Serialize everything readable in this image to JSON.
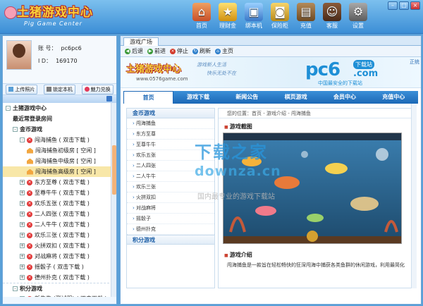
{
  "app": {
    "logo_title": "土猪游戏中心",
    "logo_subtitle": "Pig Game Center"
  },
  "toolbar": [
    {
      "label": "首页",
      "icon": "home-icon"
    },
    {
      "label": "理财金",
      "icon": "gold-icon"
    },
    {
      "label": "绑本机",
      "icon": "bind-pc-icon"
    },
    {
      "label": "保险柜",
      "icon": "safe-icon"
    },
    {
      "label": "充值",
      "icon": "recharge-icon"
    },
    {
      "label": "客服",
      "icon": "service-icon"
    },
    {
      "label": "设置",
      "icon": "settings-icon"
    }
  ],
  "window_controls": {
    "min": "–",
    "max": "□",
    "close": "×"
  },
  "user": {
    "account_label": "账  号：",
    "account_value": "pc6pc6",
    "id_label": "I  D：",
    "id_value": "169170",
    "buttons": [
      "上传照片",
      "锁定本机",
      "魅力兑换"
    ]
  },
  "tree": {
    "rows": [
      {
        "text": "土猪游戏中心",
        "indent": 0,
        "toggle": "-",
        "kind": "root"
      },
      {
        "text": "最近常登录房间",
        "indent": 1,
        "toggle": "",
        "kind": "folder"
      },
      {
        "text": "金币游戏",
        "indent": 1,
        "toggle": "-",
        "kind": "folder"
      },
      {
        "text": "闯海捕鱼  ( 双击下载 )",
        "indent": 2,
        "toggle": "-",
        "kind": "game"
      },
      {
        "text": "闯海捕鱼初级房  [ 空闲 ]",
        "indent": 3,
        "toggle": "",
        "kind": "room"
      },
      {
        "text": "闯海捕鱼中级房  [ 空闲 ]",
        "indent": 3,
        "toggle": "",
        "kind": "room"
      },
      {
        "text": "闯海捕鱼高级房  [ 空闲 ]",
        "indent": 3,
        "toggle": "",
        "kind": "room",
        "selected": true
      },
      {
        "text": "东方至尊  ( 双击下载 )",
        "indent": 2,
        "toggle": "+",
        "kind": "game"
      },
      {
        "text": "至尊牛牛  ( 双击下载 )",
        "indent": 2,
        "toggle": "+",
        "kind": "game"
      },
      {
        "text": "欢乐五张  ( 双击下载 )",
        "indent": 2,
        "toggle": "+",
        "kind": "game"
      },
      {
        "text": "二人四张  ( 双击下载 )",
        "indent": 2,
        "toggle": "+",
        "kind": "game"
      },
      {
        "text": "二人牛牛  ( 双击下载 )",
        "indent": 2,
        "toggle": "+",
        "kind": "game"
      },
      {
        "text": "欢乐三张  ( 双击下载 )",
        "indent": 2,
        "toggle": "+",
        "kind": "game"
      },
      {
        "text": "火拼双扣  ( 双击下载 )",
        "indent": 2,
        "toggle": "+",
        "kind": "game"
      },
      {
        "text": "对战麻将  ( 双击下载 )",
        "indent": 2,
        "toggle": "+",
        "kind": "game"
      },
      {
        "text": "摇骰子  ( 双击下载 )",
        "indent": 2,
        "toggle": "+",
        "kind": "game"
      },
      {
        "text": "德州扑克  ( 双击下载 )",
        "indent": 2,
        "toggle": "+",
        "kind": "game"
      },
      {
        "text": "积分游戏",
        "indent": 1,
        "toggle": "-",
        "kind": "folder",
        "sep": true
      },
      {
        "text": "新牛牛 (测试服)  ( 双击下载 )",
        "indent": 2,
        "toggle": "+",
        "kind": "game"
      }
    ]
  },
  "browser": {
    "tab": "游戏广场",
    "nav": [
      "后退",
      "前进",
      "停止",
      "刷新",
      "主页"
    ],
    "banner": {
      "site_logo": "土猪游戏中心",
      "site_url": "www.0576game.com",
      "slogan1": "游戏新人生活",
      "slogan2": "快乐无处不在",
      "pc6": "pc6",
      "pc6_tag": "下载站",
      "pc6_com": ".com",
      "pc6_cn": "中国最安全的下载站",
      "right": "正统"
    },
    "menu": [
      "首页",
      "游戏下载",
      "新闻公告",
      "棋页游戏",
      "会员中心",
      "充值中心"
    ],
    "side_sections": [
      {
        "title": "金币游戏",
        "items": [
          "闯海捕鱼",
          "东方至尊",
          "至尊牛牛",
          "欢乐五张",
          "二人四张",
          "二人牛牛",
          "欢乐三张",
          "火拼双扣",
          "对战麻将",
          "摇骰子",
          "德州扑克"
        ]
      },
      {
        "title": "积分游戏",
        "items": []
      }
    ],
    "breadcrumb": "您的位置：首页 - 游戏介绍 - 闯海捕鱼",
    "section_screenshot": "游戏截图",
    "section_intro": "游戏介绍",
    "intro_text": "闯海捕鱼是一款旨在轻松畅快的狂深闯海中捕获各类鱼群的休闲游戏，利用最简化",
    "watermark": {
      "line1": "下载之家",
      "line2": "downza.cn",
      "line3": "国内最专业的游戏下载站"
    }
  }
}
